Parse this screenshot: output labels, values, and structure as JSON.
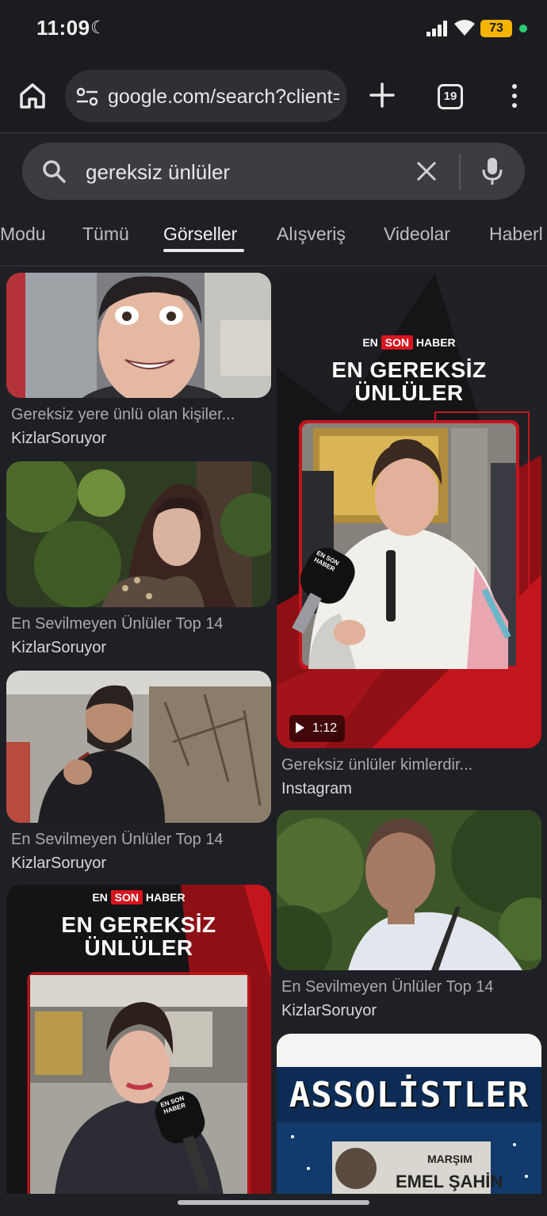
{
  "status_bar": {
    "time": "11:09",
    "battery": "73"
  },
  "browser": {
    "url": "google.com/search?client=",
    "tab_count": "19"
  },
  "search": {
    "query": "gereksiz ünlüler"
  },
  "filters": [
    "Modu",
    "Tümü",
    "Görseller",
    "Alışveriş",
    "Videolar",
    "Haberl"
  ],
  "active_filter": "Görseller",
  "results": [
    {
      "title": "Gereksiz yere ünlü olan kişiler...",
      "source": "KizlarSoruyor"
    },
    {
      "title": "En Sevilmeyen Ünlüler Top 14",
      "source": "KizlarSoruyor"
    },
    {
      "title": "En Sevilmeyen Ünlüler Top 14",
      "source": "KizlarSoruyor"
    },
    {
      "title": "Gereksiz ünlüler kimlerdir...",
      "source": "Instagram",
      "duration": "1:12"
    },
    {
      "title": "En Sevilmeyen Ünlüler Top 14",
      "source": "KizlarSoruyor"
    }
  ],
  "thumb_text": {
    "brand_en": "EN",
    "brand_son": "SON",
    "brand_haber": "HABER",
    "headline_1": "EN GEREKSİZ",
    "headline_2": "ÜNLÜLER",
    "mic_label": "EN SON HABER",
    "assolistler": "ASSOLİSTLER",
    "poster_small": "MARŞIM",
    "poster_name": "EMEL ŞAHİN"
  },
  "colors": {
    "background": "#1f2025",
    "brand_red": "#d8141e",
    "battery": "#f4b400"
  }
}
